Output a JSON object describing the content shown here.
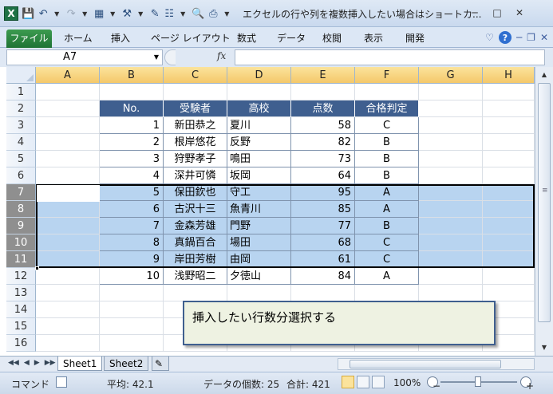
{
  "window": {
    "title": "エクセルの行や列を複数挿入したい場合はショートカ...",
    "logo": "X"
  },
  "ribbon": {
    "tabs": [
      "ファイル",
      "ホーム",
      "挿入",
      "ページ レイアウト",
      "数式",
      "データ",
      "校閲",
      "表示",
      "開発"
    ]
  },
  "formula_bar": {
    "name_box": "A7",
    "fx_label": "fx",
    "formula": ""
  },
  "grid": {
    "columns": [
      "A",
      "B",
      "C",
      "D",
      "E",
      "F",
      "G",
      "H"
    ],
    "rows": [
      "1",
      "2",
      "3",
      "4",
      "5",
      "6",
      "7",
      "8",
      "9",
      "10",
      "11",
      "12",
      "13",
      "14",
      "15",
      "16"
    ],
    "selected_rows": [
      "7",
      "8",
      "9",
      "10",
      "11"
    ],
    "table_headers": [
      "No.",
      "受験者",
      "高校",
      "点数",
      "合格判定"
    ],
    "table_rows": [
      [
        "1",
        "新田恭之",
        "夏川",
        "58",
        "C"
      ],
      [
        "2",
        "根岸悠花",
        "反野",
        "82",
        "B"
      ],
      [
        "3",
        "狩野孝子",
        "鳴田",
        "73",
        "B"
      ],
      [
        "4",
        "深井可憐",
        "坂岡",
        "64",
        "B"
      ],
      [
        "5",
        "保田欽也",
        "守工",
        "95",
        "A"
      ],
      [
        "6",
        "古沢十三",
        "魚青川",
        "85",
        "A"
      ],
      [
        "7",
        "金森芳雄",
        "門野",
        "77",
        "B"
      ],
      [
        "8",
        "真鍋百合",
        "場田",
        "68",
        "C"
      ],
      [
        "9",
        "岸田芳樹",
        "由岡",
        "61",
        "C"
      ],
      [
        "10",
        "浅野昭二",
        "夕徳山",
        "84",
        "A"
      ]
    ]
  },
  "callout": {
    "text": "挿入したい行数分選択する"
  },
  "sheets": {
    "tabs": [
      "Sheet1",
      "Sheet2"
    ],
    "active": "Sheet1"
  },
  "status": {
    "mode": "コマンド",
    "average": "平均: 42.1",
    "count": "データの個数: 25",
    "sum": "合計: 421",
    "zoom": "100%"
  },
  "colors": {
    "header_fill": "#3f5f8f",
    "selection_fill": "#b8d4f0",
    "callout_fill": "#eef2e2",
    "file_tab": "#1f7335"
  }
}
